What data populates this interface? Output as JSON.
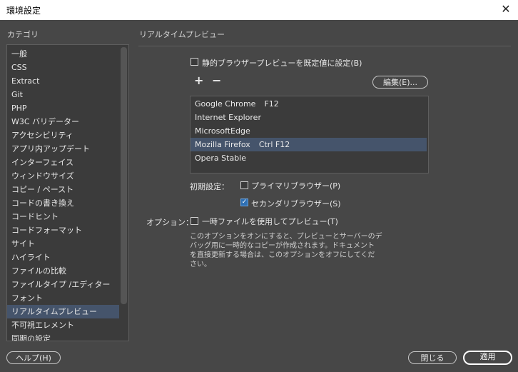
{
  "window": {
    "title": "環境設定",
    "close_label": "✕"
  },
  "category": {
    "header": "カテゴリ",
    "items": [
      "一般",
      "CSS",
      "Extract",
      "Git",
      "PHP",
      "W3C バリデーター",
      "アクセシビリティ",
      "アプリ内アップデート",
      "インターフェイス",
      "ウィンドウサイズ",
      "コピー / ペースト",
      "コードの書き換え",
      "コードヒント",
      "コードフォーマット",
      "サイト",
      "ハイライト",
      "ファイルの比較",
      "ファイルタイプ /エディター",
      "フォント",
      "リアルタイムプレビュー",
      "不可視エレメント",
      "同期の設定"
    ],
    "selected_index": 19
  },
  "panel": {
    "header": "リアルタイムプレビュー",
    "static_default_label": "静的ブラウザープレビューを既定値に設定(B)",
    "static_default_checked": false,
    "add_label": "+",
    "remove_label": "−",
    "edit_label": "編集(E)...",
    "browsers": [
      {
        "name": "Google Chrome",
        "shortcut": "F12"
      },
      {
        "name": "Internet Explorer",
        "shortcut": ""
      },
      {
        "name": "MicrosoftEdge",
        "shortcut": ""
      },
      {
        "name": "Mozilla Firefox",
        "shortcut": "Ctrl F12"
      },
      {
        "name": "Opera Stable",
        "shortcut": ""
      }
    ],
    "selected_browser_index": 3,
    "defaults_label": "初期設定：",
    "primary_label": "プライマリブラウザー(P)",
    "primary_checked": false,
    "secondary_label": "セカンダリブラウザー(S)",
    "secondary_checked": true,
    "options_label": "オプション：",
    "temp_file_label": "一時ファイルを使用してプレビュー(T)",
    "temp_file_checked": false,
    "description_lines": [
      "このオプションをオンにすると、プレビューとサーバーのデ",
      "バッグ用に一時的なコピーが作成されます。ドキュメント",
      "を直接更新する場合は、このオプションをオフにしてくだ",
      "さい。"
    ]
  },
  "footer": {
    "help_label": "ヘルプ(H)",
    "close_label": "閉じる",
    "apply_label": "適用"
  },
  "colors": {
    "background": "#474747",
    "selection": "#45546b",
    "checkbox_checked": "#2e6fb3"
  }
}
